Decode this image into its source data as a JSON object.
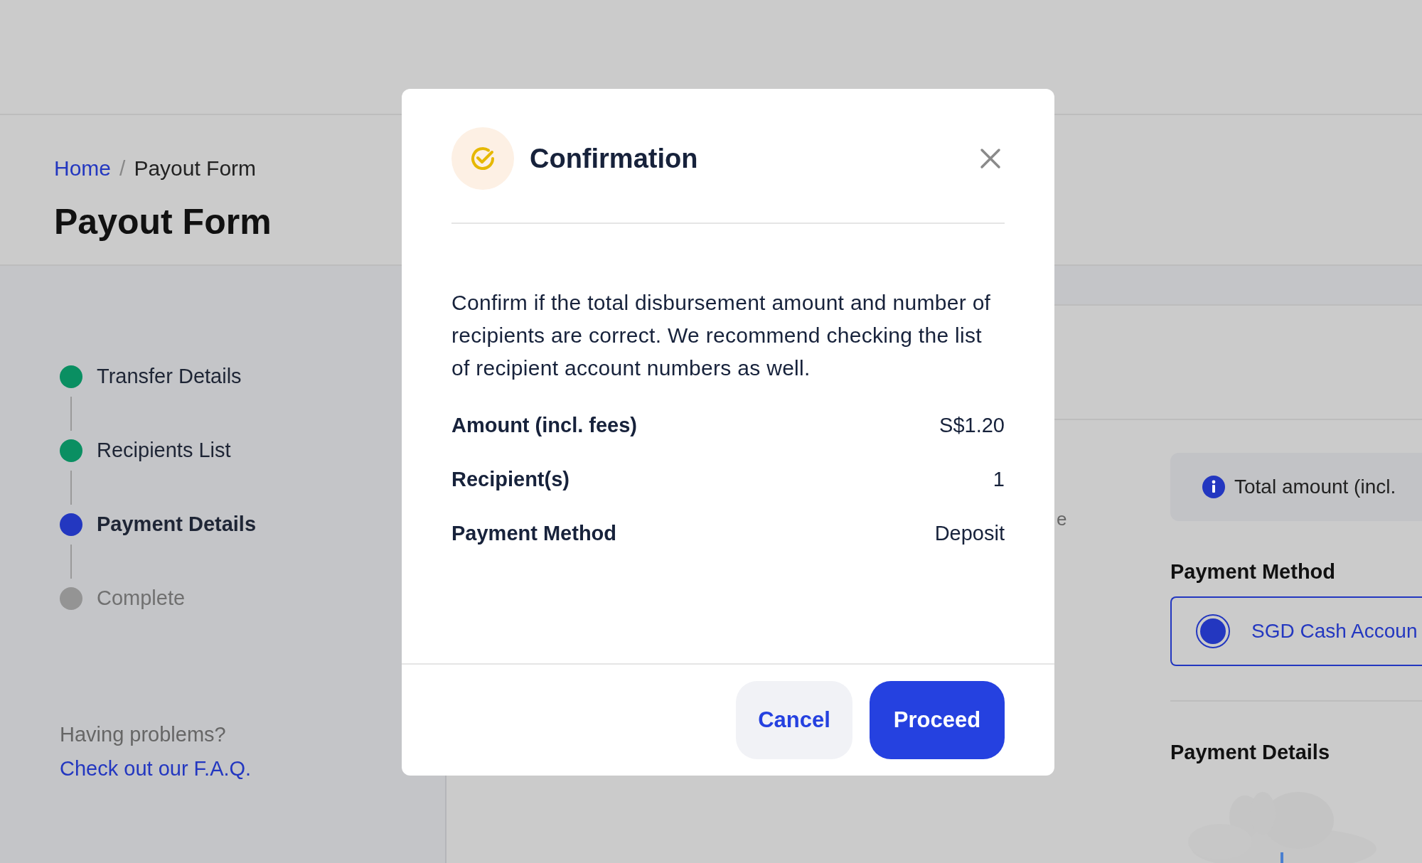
{
  "breadcrumb": [
    {
      "label": "Home",
      "kind": "link"
    },
    {
      "label": "Payout Form",
      "kind": "current"
    }
  ],
  "breadcrumb_separator": "/",
  "page_title": "Payout Form",
  "steps": [
    {
      "label": "Transfer Details",
      "completed": true,
      "selected": false
    },
    {
      "label": "Recipients List",
      "completed": true,
      "selected": false
    },
    {
      "label": "Payment Details",
      "completed": false,
      "selected": true
    },
    {
      "label": "Complete",
      "completed": false,
      "selected": false
    }
  ],
  "help": {
    "text": "Having problems?",
    "link": "Check out our F.A.Q."
  },
  "background_fragment": "e",
  "info_banner": {
    "text": "Total amount (incl."
  },
  "payment_method": {
    "label": "Payment Method",
    "options": [
      {
        "label": "SGD Cash Accoun",
        "selected": true
      }
    ]
  },
  "payment_details": {
    "label": "Payment Details"
  },
  "dialog": {
    "title": "Confirmation",
    "message": "Confirm if the total disbursement amount and number of recipients are correct. We recommend checking the list of recipient account numbers as well.",
    "rows": [
      {
        "label": "Amount (incl. fees)",
        "value": "S$1.20"
      },
      {
        "label": "Recipient(s)",
        "value": "1"
      },
      {
        "label": "Payment Method",
        "value": "Deposit"
      }
    ],
    "buttons": [
      {
        "label": "Cancel",
        "kind": "secondary"
      },
      {
        "label": "Proceed",
        "kind": "primary"
      }
    ]
  }
}
